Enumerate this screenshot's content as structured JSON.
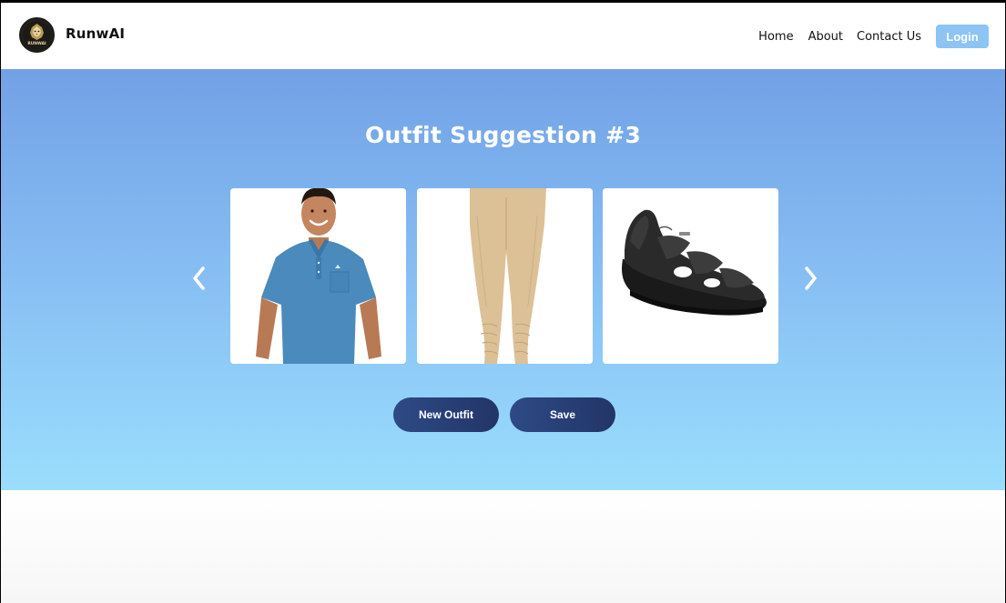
{
  "app": {
    "brand": "RunwAI",
    "logo_text": "RUNWAI"
  },
  "nav": {
    "items": [
      {
        "label": "Home"
      },
      {
        "label": "About"
      },
      {
        "label": "Contact Us"
      }
    ],
    "login_label": "Login"
  },
  "hero": {
    "title": "Outfit Suggestion #3",
    "cards": [
      {
        "item": "blue polo t-shirt",
        "image": "model-in-blue-polo"
      },
      {
        "item": "beige churidar pants",
        "image": "beige-pants"
      },
      {
        "item": "black leather sandal",
        "image": "black-sandal"
      }
    ],
    "prev_icon": "chevron-left-icon",
    "next_icon": "chevron-right-icon"
  },
  "actions": {
    "new_outfit_label": "New Outfit",
    "save_label": "Save"
  },
  "colors": {
    "hero_top": "#72a1e6",
    "hero_bottom": "#9adefd",
    "button": "#2a4178",
    "login": "#8cc4f5"
  }
}
